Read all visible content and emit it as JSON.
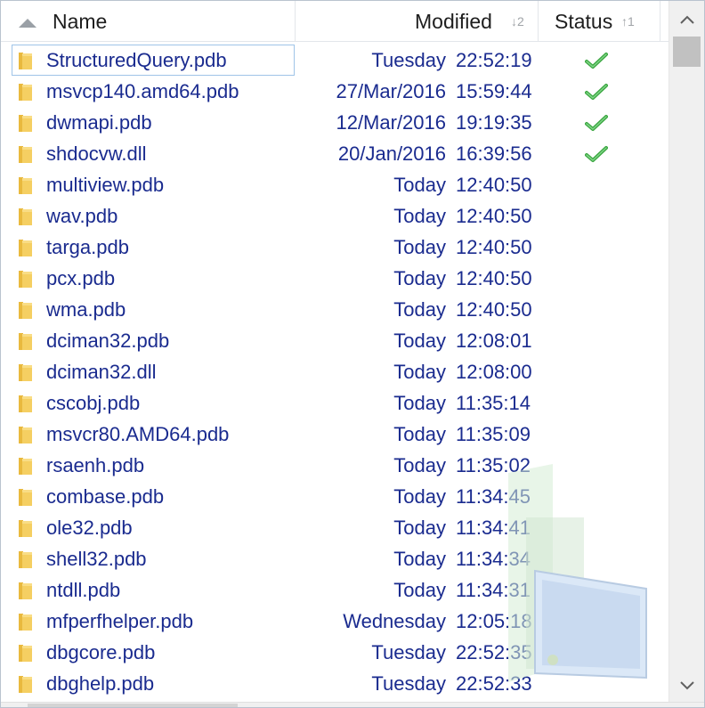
{
  "columns": {
    "name": "Name",
    "modified": "Modified",
    "modified_sort": "2",
    "status": "Status",
    "status_sort": "1"
  },
  "files": [
    {
      "name": "StructuredQuery.pdb",
      "date": "Tuesday",
      "time": "22:52:19",
      "checked": true,
      "selected": true
    },
    {
      "name": "msvcp140.amd64.pdb",
      "date": "27/Mar/2016",
      "time": "15:59:44",
      "checked": true
    },
    {
      "name": "dwmapi.pdb",
      "date": "12/Mar/2016",
      "time": "19:19:35",
      "checked": true
    },
    {
      "name": "shdocvw.dll",
      "date": "20/Jan/2016",
      "time": "16:39:56",
      "checked": true
    },
    {
      "name": "multiview.pdb",
      "date": "Today",
      "time": "12:40:50"
    },
    {
      "name": "wav.pdb",
      "date": "Today",
      "time": "12:40:50"
    },
    {
      "name": "targa.pdb",
      "date": "Today",
      "time": "12:40:50"
    },
    {
      "name": "pcx.pdb",
      "date": "Today",
      "time": "12:40:50"
    },
    {
      "name": "wma.pdb",
      "date": "Today",
      "time": "12:40:50"
    },
    {
      "name": "dciman32.pdb",
      "date": "Today",
      "time": "12:08:01"
    },
    {
      "name": "dciman32.dll",
      "date": "Today",
      "time": "12:08:00"
    },
    {
      "name": "cscobj.pdb",
      "date": "Today",
      "time": "11:35:14"
    },
    {
      "name": "msvcr80.AMD64.pdb",
      "date": "Today",
      "time": "11:35:09"
    },
    {
      "name": "rsaenh.pdb",
      "date": "Today",
      "time": "11:35:02"
    },
    {
      "name": "combase.pdb",
      "date": "Today",
      "time": "11:34:45"
    },
    {
      "name": "ole32.pdb",
      "date": "Today",
      "time": "11:34:41"
    },
    {
      "name": "shell32.pdb",
      "date": "Today",
      "time": "11:34:34"
    },
    {
      "name": "ntdll.pdb",
      "date": "Today",
      "time": "11:34:31"
    },
    {
      "name": "mfperfhelper.pdb",
      "date": "Wednesday",
      "time": "12:05:18"
    },
    {
      "name": "dbgcore.pdb",
      "date": "Tuesday",
      "time": "22:52:35"
    },
    {
      "name": "dbghelp.pdb",
      "date": "Tuesday",
      "time": "22:52:33"
    }
  ],
  "colors": {
    "text": "#1a2b8f",
    "folder": "#f5cf62",
    "check": "#3aa640",
    "selection_border": "#9fc4e8"
  },
  "icons": {
    "folder": "folder-icon",
    "check": "check-icon",
    "sort": "sort-ascending-icon"
  }
}
